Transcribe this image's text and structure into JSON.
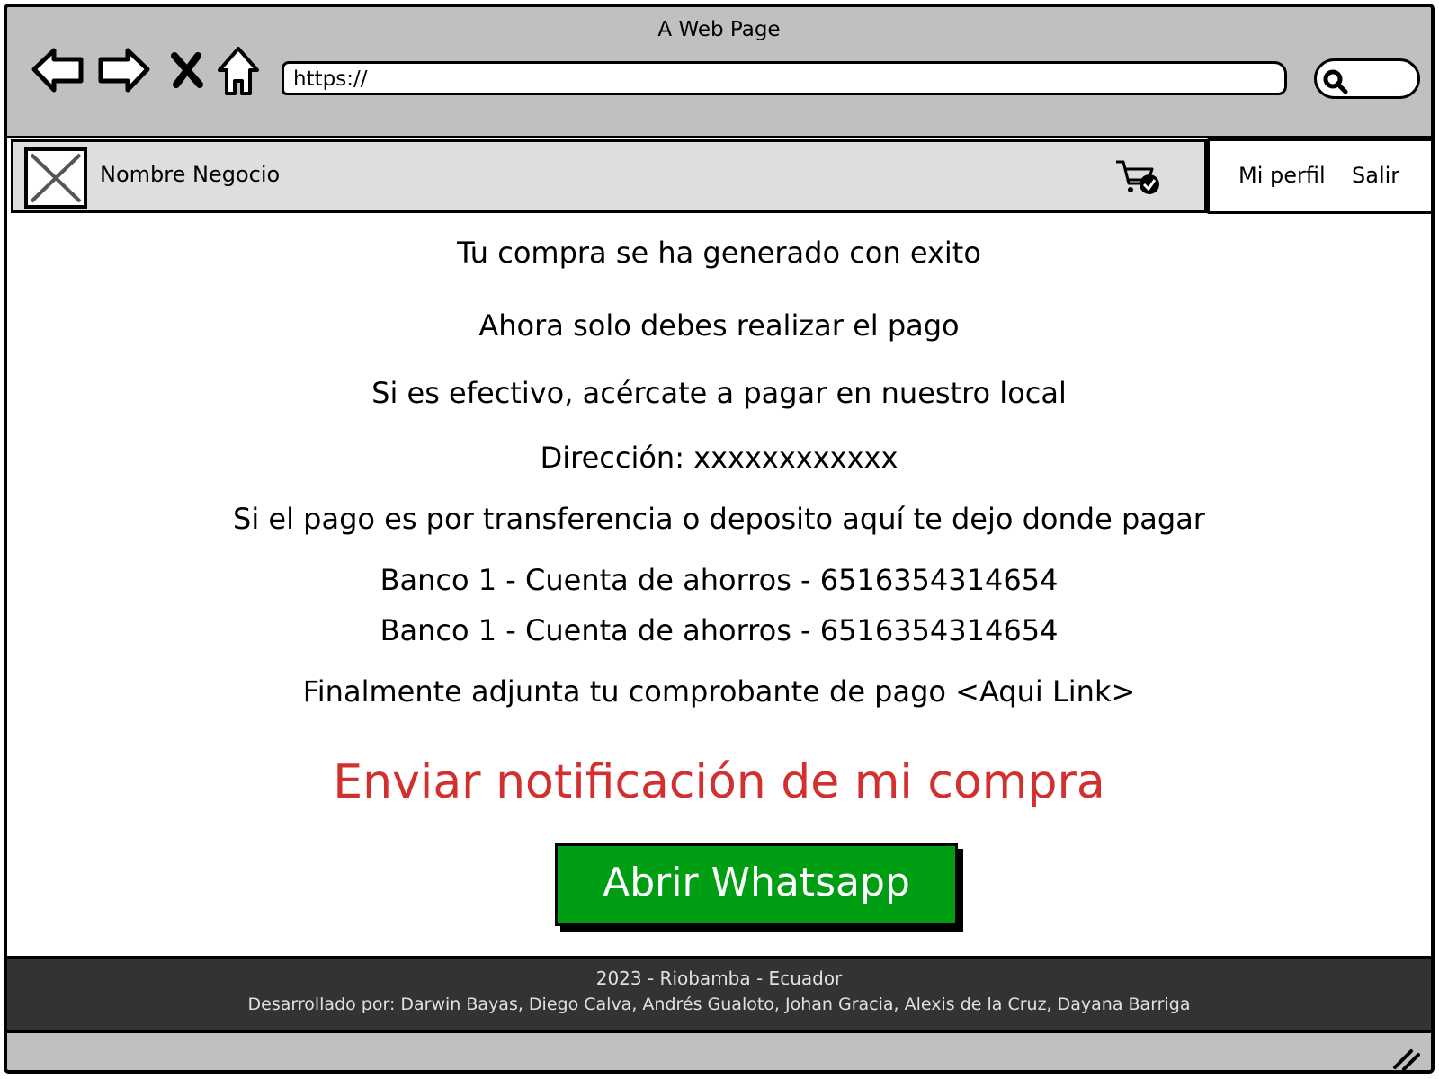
{
  "browser": {
    "title": "A Web Page",
    "url": "https://",
    "icons": [
      "back-arrow-icon",
      "forward-arrow-icon",
      "close-x-icon",
      "home-icon",
      "search-icon"
    ]
  },
  "header": {
    "business_name": "Nombre Negocio",
    "cart_icon": "cart-check-icon",
    "menu": {
      "profile": "Mi perfil",
      "logout": "Salir"
    }
  },
  "main": {
    "success": "Tu compra se ha generado con exito",
    "pay_now": "Ahora solo debes realizar el pago",
    "cash": "Si es efectivo, acércate a pagar en nuestro local",
    "address": "Dirección: xxxxxxxxxxxx",
    "transfer": "Si el pago es por transferencia o deposito aquí te dejo donde pagar",
    "bank1": "Banco 1 - Cuenta de ahorros - 6516354314654",
    "bank2": "Banco 1 - Cuenta de ahorros - 6516354314654",
    "attach": "Finalmente adjunta tu comprobante de pago <Aqui Link>",
    "notify": "Enviar notificación de mi compra",
    "whatsapp_button": "Abrir Whatsapp"
  },
  "footer": {
    "line1": "2023 - Riobamba - Ecuador",
    "line2": "Desarrollado por: Darwin Bayas, Diego Calva, Andrés Gualoto, Johan Gracia, Alexis de la Cruz, Dayana Barriga"
  },
  "colors": {
    "chrome": "#c0c0c0",
    "nav": "#dedede",
    "notify_red": "#d32f2f",
    "whatsapp_green": "#009e13",
    "footer_bg": "#333333"
  }
}
